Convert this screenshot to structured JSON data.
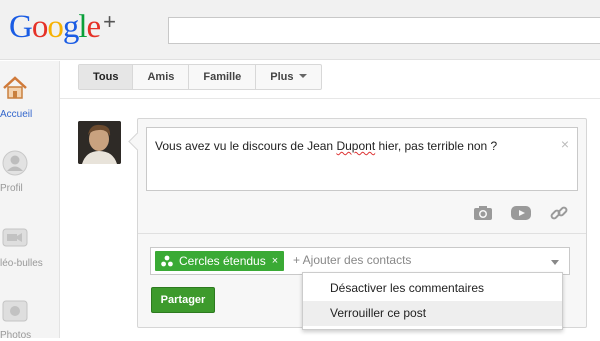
{
  "logo": {
    "text": "Google",
    "plus": "+"
  },
  "sidebar": {
    "items": [
      {
        "label": "Accueil",
        "icon": "home-icon",
        "active": true
      },
      {
        "label": "Profil",
        "icon": "profile-icon",
        "active": false
      },
      {
        "label": "léo-bulles",
        "icon": "hangout-icon",
        "active": false
      },
      {
        "label": "Photos",
        "icon": "photos-icon",
        "active": false
      }
    ]
  },
  "tabs": [
    {
      "label": "Tous",
      "active": true
    },
    {
      "label": "Amis",
      "active": false
    },
    {
      "label": "Famille",
      "active": false
    },
    {
      "label": "Plus",
      "active": false
    }
  ],
  "share": {
    "text_before": "Vous avez vu le discours de Jean ",
    "text_misspelled": "Dupont",
    "text_after": " hier, pas terrible non ?",
    "clear_icon": "×",
    "media_icons": [
      "camera-icon",
      "video-icon",
      "link-icon"
    ],
    "chip_label": "Cercles étendus",
    "chip_remove": "×",
    "add_contacts": "+ Ajouter des contacts",
    "button_label": "Partager"
  },
  "menu": {
    "items": [
      {
        "label": "Désactiver les commentaires",
        "highlighted": false
      },
      {
        "label": "Verrouiller ce post",
        "highlighted": true
      }
    ]
  },
  "colors": {
    "accent_green": "#3aaa35",
    "share_button": "#3d9a2c",
    "link_blue": "#3366cc"
  }
}
